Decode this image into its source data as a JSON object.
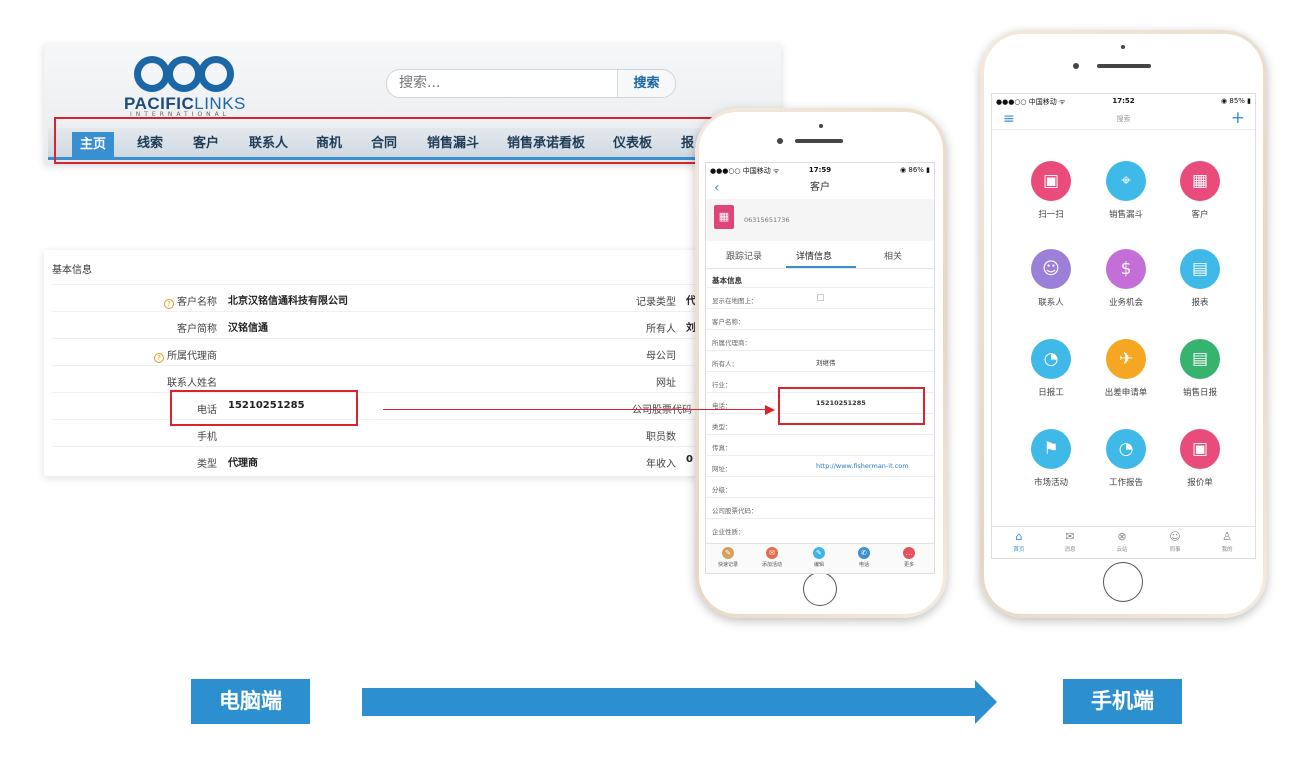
{
  "desktop": {
    "logo": {
      "brand_part1": "PACIFIC",
      "brand_part2": "LINKS",
      "tagline": "INTERNATIONAL"
    },
    "search": {
      "placeholder": "搜索...",
      "button": "搜索"
    },
    "nav": [
      "主页",
      "线索",
      "客户",
      "联系人",
      "商机",
      "合同",
      "销售漏斗",
      "销售承诺看板",
      "仪表板",
      "报"
    ],
    "basic_info": {
      "title": "基本信息",
      "rows": [
        {
          "label": "客户名称",
          "value": "北京汉铭信通科技有限公司",
          "right_label": "记录类型",
          "right_value": "代",
          "help": true
        },
        {
          "label": "客户简称",
          "value": "汉铭信通",
          "right_label": "所有人",
          "right_value": "刘"
        },
        {
          "label": "所属代理商",
          "value": "",
          "right_label": "母公司",
          "right_value": "",
          "help": true
        },
        {
          "label": "联系人姓名",
          "value": "",
          "right_label": "网址",
          "right_value": ""
        },
        {
          "label": "电话",
          "value": "15210251285",
          "right_label": "公司股票代码",
          "right_value": ""
        },
        {
          "label": "手机",
          "value": "",
          "right_label": "职员数",
          "right_value": ""
        },
        {
          "label": "类型",
          "value": "代理商",
          "right_label": "年收入",
          "right_value": "0"
        }
      ]
    }
  },
  "phone_detail": {
    "status": {
      "carrier": "●●●○○ 中国移动 ᯤ",
      "time": "17:59",
      "battery": "◉ 86% ▮"
    },
    "title": "客户",
    "account_number": "06315651736",
    "tabs": [
      "跟踪记录",
      "详情信息",
      "相关"
    ],
    "section": "基本信息",
    "fields": [
      {
        "key": "显示在地图上：",
        "value": ""
      },
      {
        "key": "客户名称：",
        "value": ""
      },
      {
        "key": "所属代理商：",
        "value": ""
      },
      {
        "key": "所有人：",
        "value": "刘继伟"
      },
      {
        "key": "行业：",
        "value": ""
      },
      {
        "key": "电话：",
        "value": "15210251285"
      },
      {
        "key": "类型：",
        "value": ""
      },
      {
        "key": "传真：",
        "value": ""
      },
      {
        "key": "网址：",
        "value": "http://www.fisherman-it.com"
      },
      {
        "key": "分级：",
        "value": ""
      },
      {
        "key": "公司股票代码：",
        "value": ""
      },
      {
        "key": "企业性质：",
        "value": ""
      }
    ],
    "actions": [
      {
        "label": "快速记录",
        "color": "#d9a05b"
      },
      {
        "label": "添加活动",
        "color": "#e46b4b"
      },
      {
        "label": "编辑",
        "color": "#3fb4e6"
      },
      {
        "label": "电话",
        "color": "#3a8fd1"
      },
      {
        "label": "更多",
        "color": "#e5525d"
      }
    ]
  },
  "phone_home": {
    "status": {
      "carrier": "●●●○○ 中国移动 ᯤ",
      "time": "17:52",
      "battery": "◉ 85% ▮"
    },
    "search_placeholder": "搜索",
    "apps": [
      {
        "label": "扫一扫",
        "color": "#e94c7b",
        "icon": "scan-icon"
      },
      {
        "label": "销售漏斗",
        "color": "#3fb9e8",
        "icon": "location-icon"
      },
      {
        "label": "客户",
        "color": "#e94c7b",
        "icon": "building-icon"
      },
      {
        "label": "联系人",
        "color": "#9b7fd9",
        "icon": "contact-icon"
      },
      {
        "label": "业务机会",
        "color": "#c46fd8",
        "icon": "money-bag-icon"
      },
      {
        "label": "报表",
        "color": "#3fb9e8",
        "icon": "report-icon"
      },
      {
        "label": "日报工",
        "color": "#3fb9e8",
        "icon": "daily-report-icon"
      },
      {
        "label": "出差申请单",
        "color": "#f5a623",
        "icon": "travel-icon"
      },
      {
        "label": "销售日报",
        "color": "#36b36c",
        "icon": "sales-daily-icon"
      },
      {
        "label": "市场活动",
        "color": "#3fb9e8",
        "icon": "campaign-icon"
      },
      {
        "label": "工作报告",
        "color": "#3fb9e8",
        "icon": "work-report-icon"
      },
      {
        "label": "报价单",
        "color": "#e94c7b",
        "icon": "quote-icon"
      }
    ],
    "tabbar": [
      "首页",
      "消息",
      "云站",
      "同事",
      "我的"
    ]
  },
  "bottom": {
    "left_label": "电脑端",
    "right_label": "手机端"
  }
}
